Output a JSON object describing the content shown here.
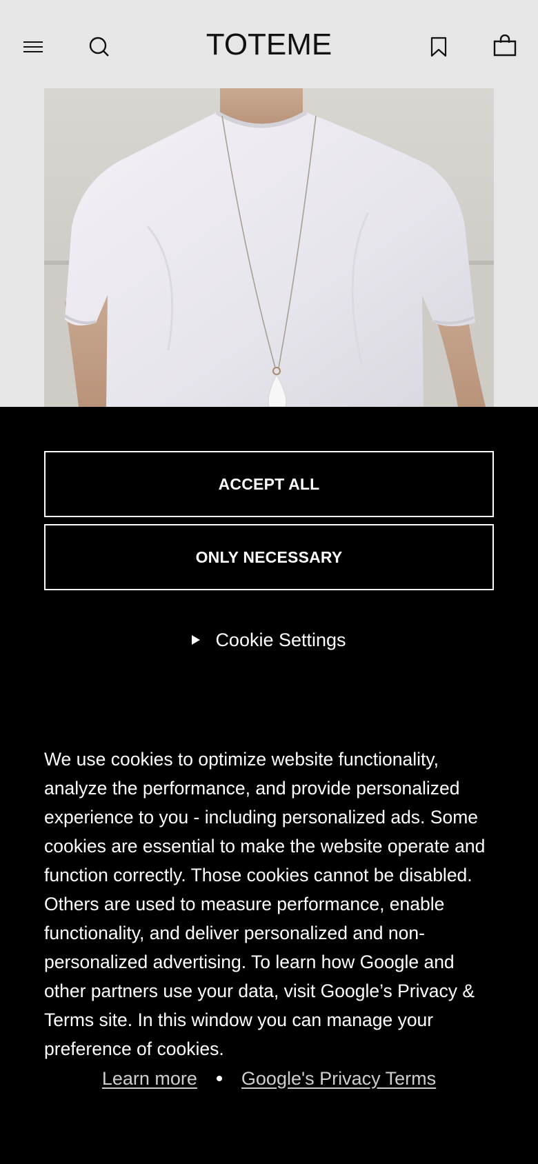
{
  "header": {
    "logo": "TOTEME",
    "icons": {
      "menu": "hamburger-menu-icon",
      "search": "search-icon",
      "wishlist": "bookmark-icon",
      "bag": "shopping-bag-icon"
    }
  },
  "hero": {
    "alt": "Model wearing white t-shirt and pendant necklace"
  },
  "cookie_banner": {
    "accept_all": "ACCEPT ALL",
    "only_necessary": "ONLY NECESSARY",
    "settings_label": "Cookie Settings",
    "body": "We use cookies to optimize website functionality, analyze the performance, and provide personalized experience to you - including personalized ads. Some cookies are essential to make the website operate and function correctly. Those cookies cannot be disabled. Others are used to measure performance, enable functionality, and deliver personalized and non-personalized advertising. To learn how Google and other partners use your data, visit Google’s Privacy & Terms site. In this window you can manage your preference of cookies.",
    "learn_more": "Learn more",
    "privacy_terms": "Google's Privacy Terms"
  },
  "colors": {
    "header_bg": "#e6e6e6",
    "banner_bg": "#000000",
    "text_light": "#ffffff"
  }
}
